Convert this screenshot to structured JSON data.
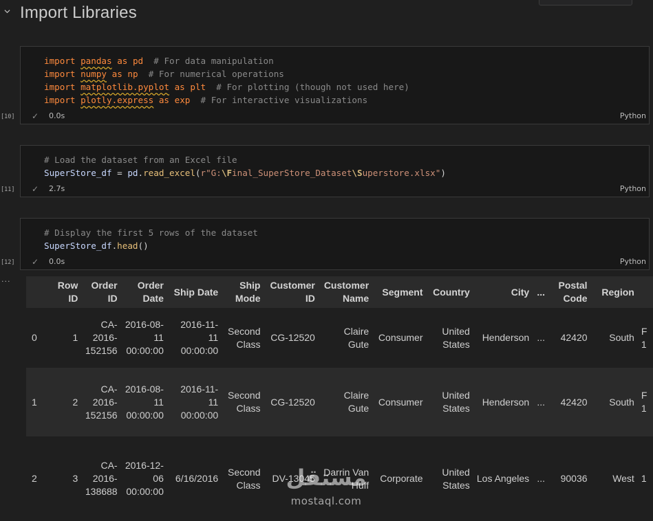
{
  "section": {
    "title": "Import Libraries"
  },
  "cells": [
    {
      "exec_count": "[10]",
      "time": "0.0s",
      "language": "Python",
      "lines": [
        {
          "kw": "import",
          "mod": "pandas",
          "as": "as",
          "alias": "pd",
          "comment": "# For data manipulation"
        },
        {
          "kw": "import",
          "mod": "numpy",
          "as": "as",
          "alias": "np",
          "comment": "# For numerical operations"
        },
        {
          "kw": "import",
          "mod": "matplotlib.pyplot",
          "as": "as",
          "alias": "plt",
          "comment": "# For plotting (though not used here)"
        },
        {
          "kw": "import",
          "mod": "plotly.express",
          "as": "as",
          "alias": "exp",
          "comment": "# For interactive visualizations"
        }
      ]
    },
    {
      "exec_count": "[11]",
      "time": "2.7s",
      "language": "Python",
      "comment": "# Load the dataset from an Excel file",
      "var": "SuperStore_df",
      "eq": " = ",
      "obj": "pd",
      "dot": ".",
      "fn": "read_excel",
      "open": "(",
      "str_prefix": "r\"G:",
      "esc1": "\\F",
      "str_mid": "inal_SuperStore_Dataset",
      "esc2": "\\S",
      "str_end": "uperstore.xlsx\"",
      "close": ")"
    },
    {
      "exec_count": "[12]",
      "time": "0.0s",
      "language": "Python",
      "comment": "# Display the first 5 rows of the dataset",
      "var": "SuperStore_df",
      "dot": ".",
      "fn": "head",
      "call": "()"
    }
  ],
  "output": {
    "more": "...",
    "columns": [
      "",
      "Row ID",
      "Order ID",
      "Order Date",
      "Ship Date",
      "Ship Mode",
      "Customer ID",
      "Customer Name",
      "Segment",
      "Country",
      "City",
      "...",
      "Postal Code",
      "Region",
      ""
    ],
    "rows": [
      [
        "0",
        "1",
        "CA-2016-152156",
        "2016-08-11 00:00:00",
        "2016-11-11 00:00:00",
        "Second Class",
        "CG-12520",
        "Claire Gute",
        "Consumer",
        "United States",
        "Henderson",
        "...",
        "42420",
        "South",
        "F 1"
      ],
      [
        "1",
        "2",
        "CA-2016-152156",
        "2016-08-11 00:00:00",
        "2016-11-11 00:00:00",
        "Second Class",
        "CG-12520",
        "Claire Gute",
        "Consumer",
        "United States",
        "Henderson",
        "...",
        "42420",
        "South",
        "F 1"
      ],
      [
        "2",
        "3",
        "CA-2016-138688",
        "2016-12-06 00:00:00",
        "6/16/2016",
        "Second Class",
        "DV-13045",
        "Darrin Van Huff",
        "Corporate",
        "United States",
        "Los Angeles",
        "...",
        "90036",
        "West",
        "1"
      ]
    ]
  },
  "watermark": {
    "arabic": "مستقل",
    "latin": "mostaql.com"
  }
}
